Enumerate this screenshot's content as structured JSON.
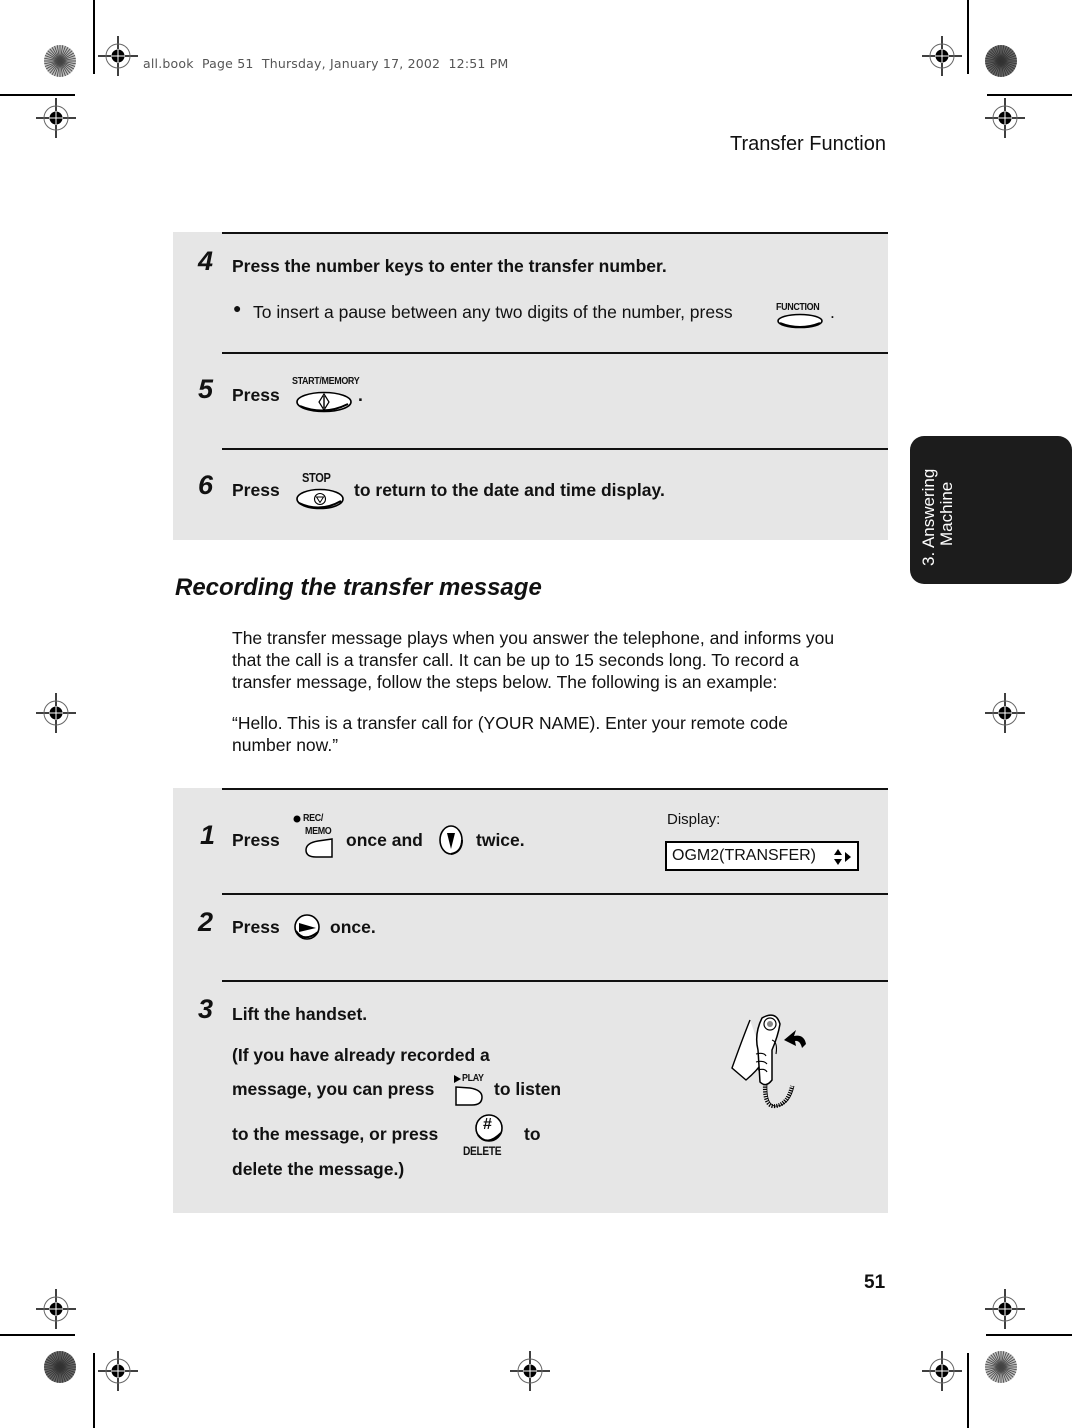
{
  "printer_slug": "all.book  Page 51  Thursday, January 17, 2002  12:51 PM",
  "running_head": "Transfer Function",
  "page_number": "51",
  "side_tab": {
    "line1": "3. Answering",
    "line2": "Machine"
  },
  "steps_top": [
    {
      "number": "4",
      "text": "Press the number keys to enter the transfer number.",
      "bullet": "To insert a pause between any two digits of the number, press",
      "bullet_end": ".",
      "key": {
        "label": "FUNCTION",
        "icon": "function-key-icon"
      }
    },
    {
      "number": "5",
      "text_before": "Press",
      "text_after": ".",
      "key": {
        "label": "START/MEMORY",
        "icon": "start-memory-key-icon"
      }
    },
    {
      "number": "6",
      "text_before": "Press",
      "text_after": "to return to the date and time display.",
      "key": {
        "label": "STOP",
        "icon": "stop-key-icon"
      }
    }
  ],
  "section": {
    "title": "Recording the transfer message",
    "paragraph_lines": [
      "The transfer message plays when you answer the telephone, and informs you",
      "that the call is a transfer call. It can be up to 15 seconds long. To record a",
      "transfer message, follow the steps below. The following is an example:"
    ],
    "example_lines": [
      "“Hello. This is a transfer call for (YOUR NAME). Enter your remote code",
      "number now.”"
    ]
  },
  "steps_bottom": [
    {
      "number": "1",
      "text_before": "Press",
      "text_middle": "once and",
      "text_after": "twice.",
      "key1": {
        "label_line1": "REC/",
        "label_line2": "MEMO",
        "icon": "rec-memo-key-icon"
      },
      "key2": {
        "icon": "down-arrow-key-icon"
      },
      "display": {
        "label": "Display:",
        "value": "OGM2(TRANSFER)"
      }
    },
    {
      "number": "2",
      "text_before": "Press",
      "text_after": "once.",
      "key": {
        "icon": "right-arrow-key-icon"
      }
    },
    {
      "number": "3",
      "text": "Lift the handset.",
      "lines": [
        "(If you have already recorded a",
        "message, you can press",
        "to listen",
        "to the message, or press",
        "to",
        "delete the message.)"
      ],
      "play_key": {
        "label": "PLAY",
        "icon": "play-key-icon"
      },
      "delete_key": {
        "symbol": "#",
        "label": "DELETE",
        "icon": "delete-key-icon"
      },
      "illustration": "handset-lift-icon"
    }
  ]
}
